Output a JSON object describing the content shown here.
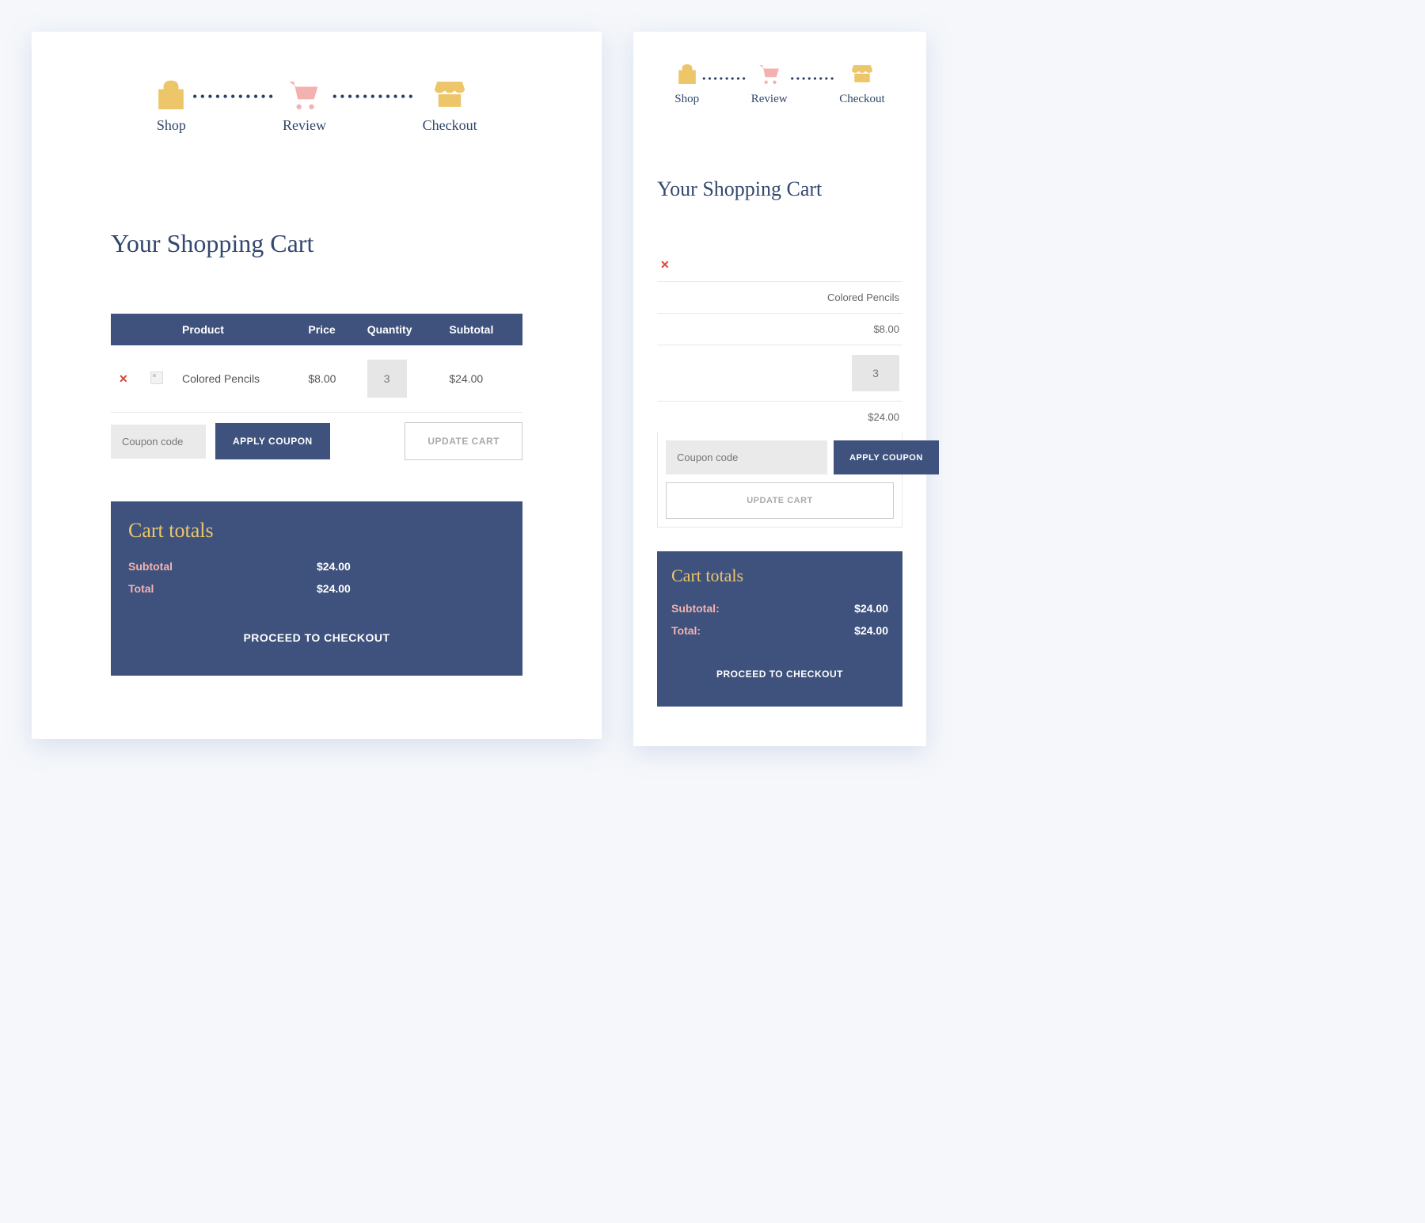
{
  "stepper": {
    "steps": [
      {
        "label": "Shop"
      },
      {
        "label": "Review"
      },
      {
        "label": "Checkout"
      }
    ]
  },
  "title": "Your Shopping Cart",
  "table": {
    "headers": {
      "product": "Product",
      "price": "Price",
      "quantity": "Quantity",
      "subtotal": "Subtotal"
    },
    "row": {
      "name": "Colored Pencils",
      "price": "$8.00",
      "qty": "3",
      "subtotal": "$24.00"
    }
  },
  "actions": {
    "coupon_placeholder": "Coupon code",
    "apply": "APPLY COUPON",
    "update": "UPDATE CART"
  },
  "totals": {
    "heading": "Cart totals",
    "subtotal_label": "Subtotal",
    "subtotal_label_m": "Subtotal:",
    "subtotal_value": "$24.00",
    "total_label": "Total",
    "total_label_m": "Total:",
    "total_value": "$24.00",
    "proceed": "PROCEED TO CHECKOUT"
  },
  "mobile": {
    "name": "Colored Pencils",
    "price": "$8.00",
    "qty": "3",
    "subtotal": "$24.00"
  }
}
